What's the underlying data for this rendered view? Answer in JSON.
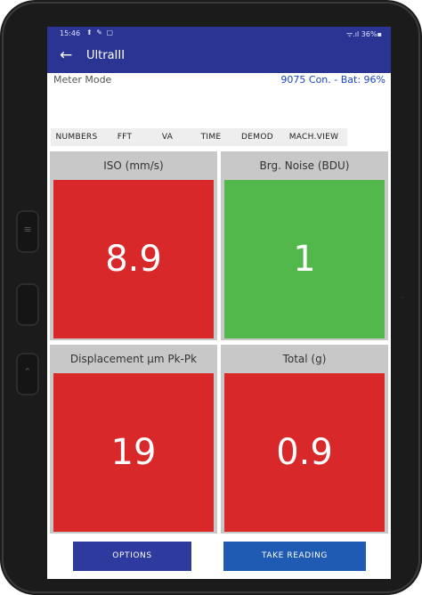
{
  "status_bar": {
    "time": "15:46",
    "left_icons": "⬆ ✎ ▢",
    "right_text": "ᯤ.ıl 36%▪"
  },
  "app_bar": {
    "back_icon": "←",
    "title": "UltraIII"
  },
  "meter": {
    "mode_label": "Meter Mode",
    "device_info": "9075 Con. - Bat: 96%"
  },
  "tabs": [
    {
      "label": "NUMBERS"
    },
    {
      "label": "FFT"
    },
    {
      "label": "VA"
    },
    {
      "label": "TIME"
    },
    {
      "label": "DEMOD"
    },
    {
      "label": "MACH.VIEW"
    }
  ],
  "tiles": [
    {
      "title": "ISO (mm/s)",
      "value": "8.9",
      "color": "#d8282a"
    },
    {
      "title": "Brg. Noise (BDU)",
      "value": "1",
      "color": "#52b84c"
    },
    {
      "title": "Displacement µm Pk-Pk",
      "value": "19",
      "color": "#d8282a"
    },
    {
      "title": "Total (g)",
      "value": "0.9",
      "color": "#d8282a"
    }
  ],
  "buttons": {
    "options_label": "OPTIONS",
    "take_reading_label": "TAKE READING",
    "options_color": "#2f3a9e",
    "take_reading_color": "#1f5ab3"
  },
  "device": {
    "side_key_icons": [
      "menu-icon",
      "chevron-up-icon"
    ]
  }
}
